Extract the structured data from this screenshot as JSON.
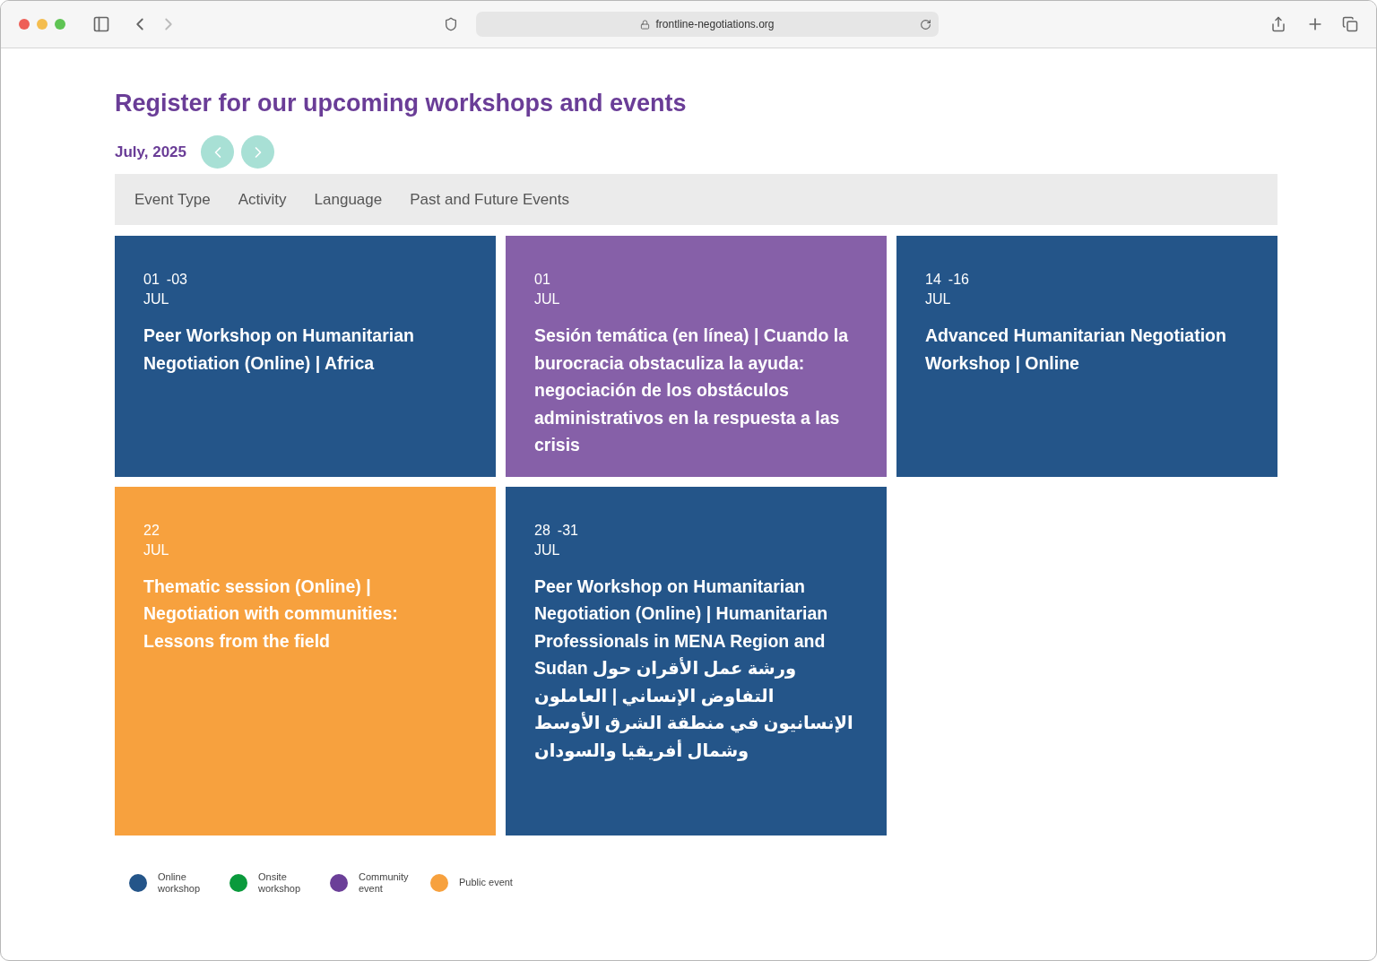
{
  "browser": {
    "url": "frontline-negotiations.org"
  },
  "heading": "Register for our upcoming workshops and events",
  "month": "July, 2025",
  "filters": [
    {
      "label": "Event Type"
    },
    {
      "label": "Activity"
    },
    {
      "label": "Language"
    },
    {
      "label": "Past and Future Events"
    }
  ],
  "events": [
    {
      "start": "01",
      "end": "-03",
      "month": "JUL",
      "title": "Peer Workshop on Humanitarian Negotiation (Online) | Africa",
      "color": "#245589"
    },
    {
      "start": "01",
      "month": "JUL",
      "title": "Sesión temática (en línea) | Cuando la burocracia obstaculiza la ayuda: negociación de los obstáculos administrativos en la respuesta a las crisis",
      "color": "#8660a8"
    },
    {
      "start": "14",
      "end": "-16",
      "month": "JUL",
      "title": "Advanced Humanitarian Negotiation Workshop | Online",
      "color": "#245589"
    },
    {
      "start": "22",
      "month": "JUL",
      "title": "Thematic session (Online) | Negotiation with communities: Lessons from the field",
      "color": "#f7a13e"
    },
    {
      "start": "28",
      "end": "-31",
      "month": "JUL",
      "title": "Peer Workshop on Humanitarian Negotiation (Online) | Humanitarian Professionals in MENA Region and Sudan ورشة عمل الأقران حول التفاوض الإنساني | العاملون الإنسانيون في منطقة الشرق الأوسط وشمال أفريقيا والسودان",
      "color": "#245589"
    }
  ],
  "legend": [
    {
      "label": "Online workshop",
      "color": "#245589"
    },
    {
      "label": "Onsite workshop",
      "color": "#0a9a3c"
    },
    {
      "label": "Community event",
      "color": "#6b3f98"
    },
    {
      "label": "Public event",
      "color": "#f7a13e"
    }
  ]
}
